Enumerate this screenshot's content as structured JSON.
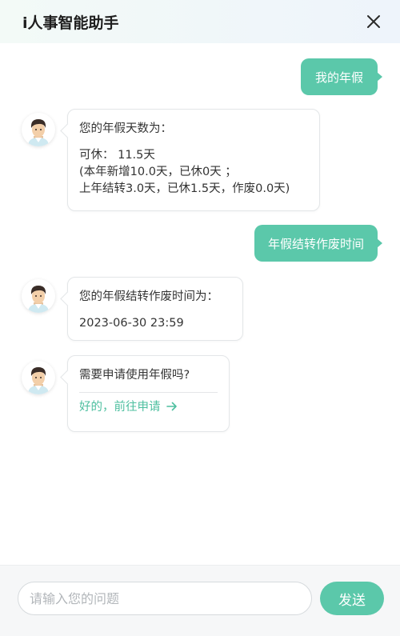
{
  "header": {
    "title": "i人事智能助手",
    "close_icon": "close-icon"
  },
  "messages": {
    "user1": "我的年假",
    "bot1": {
      "line1": "您的年假天数为：",
      "line2": "可休：  11.5天",
      "line3": "(本年新增10.0天，已休0天 ；",
      "line4": "上年结转3.0天，已休1.5天，作废0.0天)"
    },
    "user2": "年假结转作废时间",
    "bot2": {
      "line1": "您的年假结转作废时间为：",
      "line2": "2023-06-30    23:59"
    },
    "bot3": {
      "question": "需要申请使用年假吗?",
      "link": "好的，前往申请",
      "link_icon": "arrow-right-icon"
    }
  },
  "footer": {
    "input_placeholder": "请输入您的问题",
    "send_label": "发送"
  },
  "colors": {
    "accent": "#5bc8aa",
    "link": "#4dbf9f",
    "header_bg": "#f1f8f6"
  }
}
